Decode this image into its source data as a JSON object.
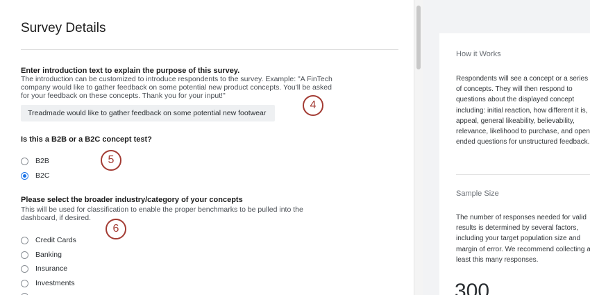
{
  "survey": {
    "title": "Survey Details",
    "intro": {
      "heading": "Enter introduction text to explain the purpose of this survey.",
      "description": "The introduction can be customized to introduce respondents to the survey. Example: \"A FinTech company would like to gather feedback on some potential new product concepts. You'll be asked for your feedback on these concepts. Thank you for your input!\"",
      "value": "Treadmade would like to gather feedback on some potential new footwear options."
    },
    "test_type": {
      "heading": "Is this a B2B or a B2C concept test?",
      "options": [
        "B2B",
        "B2C"
      ],
      "selected": "B2C"
    },
    "industry": {
      "heading": "Please select the broader industry/category of your concepts",
      "description": "This will be used for classification to enable the proper benchmarks to be pulled into the dashboard, if desired.",
      "options": [
        "Credit Cards",
        "Banking",
        "Insurance",
        "Investments"
      ]
    }
  },
  "callouts": [
    "4",
    "5",
    "6"
  ],
  "side_panel": {
    "how_it_works": {
      "heading": "How it Works",
      "text": "Respondents will see a concept or a series of concepts. They will then respond to questions about the displayed concept including: initial reaction, how different it is, appeal, general likeability, believability, relevance, likelihood to purchase, and open-ended questions for unstructured feedback."
    },
    "sample_size": {
      "heading": "Sample Size",
      "text": "The number of responses needed for valid results is determined by several factors, including your target population size and margin of error. We recommend collecting at least this many responses.",
      "value": "300"
    }
  },
  "colors": {
    "accent": "#1a73e8",
    "callout": "#a33b33",
    "panel_bg": "#f2f3f5"
  }
}
